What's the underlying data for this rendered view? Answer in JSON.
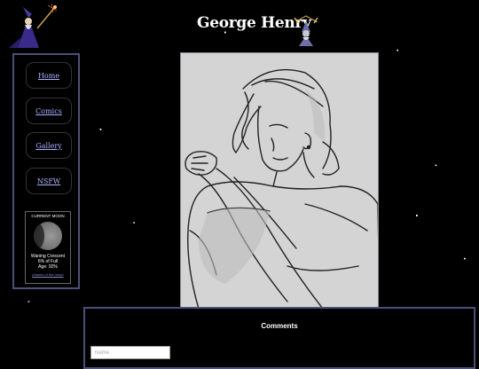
{
  "header": {
    "title": "George Henry",
    "logo_icon": "wizard-icon",
    "mascot_icon": "wizard-mascot-icon"
  },
  "sidebar": {
    "items": [
      {
        "label": "Home"
      },
      {
        "label": "Comics"
      },
      {
        "label": "Gallery"
      },
      {
        "label": "NSFW"
      }
    ],
    "moon": {
      "title": "CURRENT MOON",
      "phase": "Waning Crescent",
      "percent_full": "6% of Full",
      "age": "Age: 92%",
      "link": "phases of the moon"
    }
  },
  "main": {
    "artwork_icon": "character-sketch-illustration"
  },
  "comments": {
    "heading": "Comments",
    "name_placeholder": "Name"
  },
  "colors": {
    "background": "#000000",
    "panel_border": "#4a5078",
    "link": "#aab0ff",
    "artwork_bg": "#d4d4d4"
  }
}
